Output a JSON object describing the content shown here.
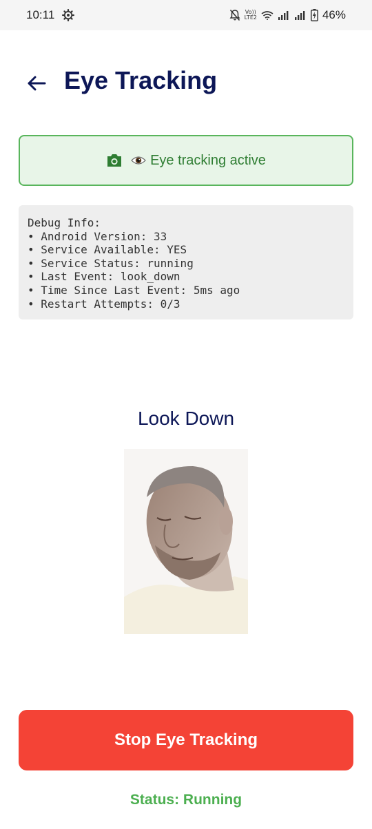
{
  "status_bar": {
    "time": "10:11",
    "volte_top": "Vo))",
    "volte_bottom": "LTE2",
    "battery": "46%"
  },
  "header": {
    "title": "Eye Tracking"
  },
  "banner": {
    "text": "Eye tracking active",
    "color": "#2e7d32",
    "background": "#e8f5e8",
    "border": "#59b55c"
  },
  "debug": {
    "lines": [
      "Debug Info:",
      "• Android Version: 33",
      "• Service Available: YES",
      "• Service Status: running",
      "• Last Event: look_down",
      "• Time Since Last Event: 5ms ago",
      "• Restart Attempts: 0/3"
    ]
  },
  "direction": {
    "label": "Look Down"
  },
  "actions": {
    "stop_label": "Stop Eye Tracking",
    "stop_color": "#f44336"
  },
  "footer": {
    "status_text": "Status: Running",
    "status_color": "#4caf50"
  },
  "icons": {
    "back": "back-arrow-icon",
    "camera": "camera-icon",
    "eye": "eye-icon"
  }
}
